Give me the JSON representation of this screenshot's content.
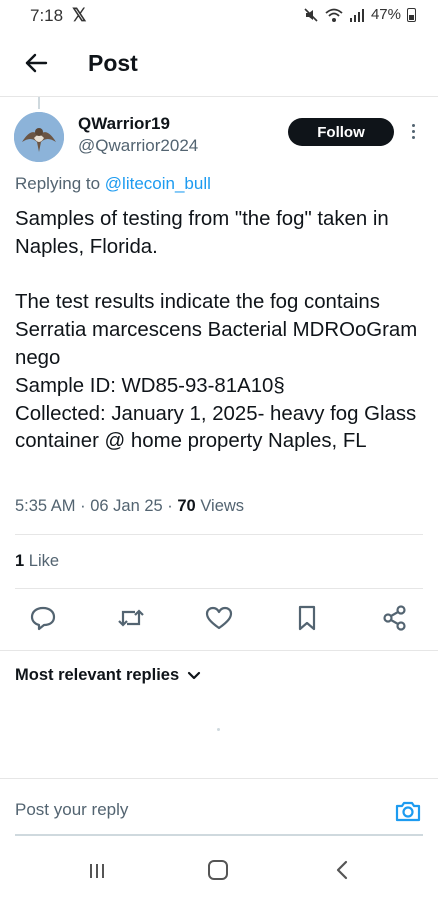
{
  "status_bar": {
    "time": "7:18",
    "app_icon": "x-logo",
    "battery": "47%",
    "icons": [
      "mute-icon",
      "wifi-icon",
      "signal-icon",
      "battery-icon"
    ]
  },
  "header": {
    "title": "Post",
    "back_icon": "back-arrow-icon"
  },
  "post": {
    "author_name": "QWarrior19",
    "author_handle": "@Qwarrior2024",
    "follow_label": "Follow",
    "replying_prefix": "Replying to ",
    "replying_to": "@litecoin_bull",
    "text": "Samples of testing from \"the fog\" taken in Naples, Florida.\n\nThe test results indicate the fog contains Serratia marcescens Bacterial MDROoGram nego\nSample ID: WD85-93-81A10§\nCollected: January 1, 2025- heavy fog Glass container @ home property Naples, FL",
    "time": "5:35 AM",
    "date": "06 Jan 25",
    "views_count": "70",
    "views_label": "Views",
    "likes_count": "1",
    "likes_label": "Like"
  },
  "actions": [
    "reply-icon",
    "repost-icon",
    "like-icon",
    "bookmark-icon",
    "share-icon"
  ],
  "replies": {
    "sort_label": "Most relevant replies"
  },
  "composer": {
    "placeholder": "Post your reply"
  },
  "colors": {
    "accent": "#1d9bf0",
    "text": "#0f1419",
    "muted": "#536471",
    "divider": "#e6e6e6"
  }
}
